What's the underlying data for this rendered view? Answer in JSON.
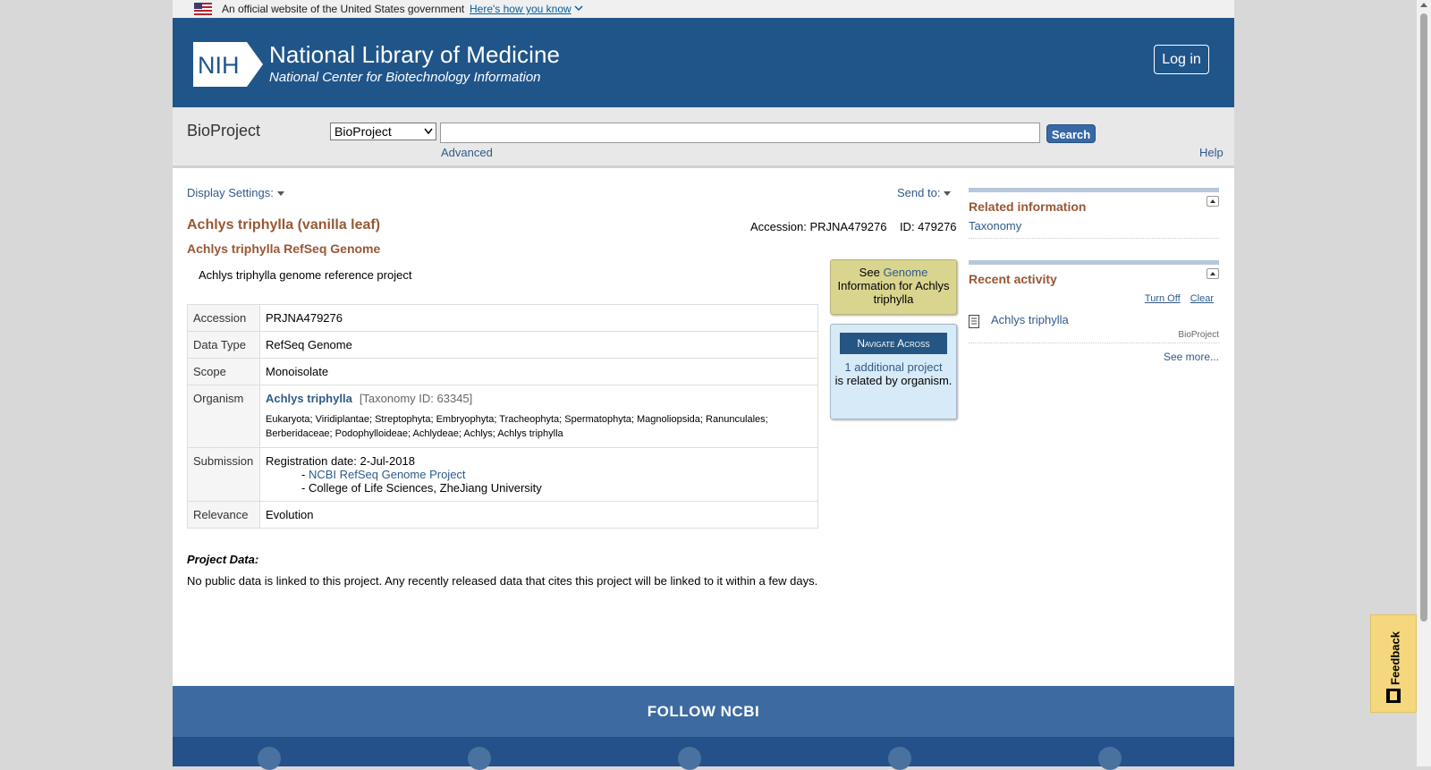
{
  "gov_banner": {
    "text": "An official website of the United States government",
    "link": "Here's how you know"
  },
  "header": {
    "logo_text": "NIH",
    "title": "National Library of Medicine",
    "subtitle": "National Center for Biotechnology Information",
    "login": "Log in"
  },
  "search": {
    "db_name": "BioProject",
    "db_selected": "BioProject",
    "query": "",
    "button": "Search",
    "advanced": "Advanced",
    "help": "Help"
  },
  "toolbar": {
    "display_settings": "Display Settings:",
    "send_to": "Send to:"
  },
  "record": {
    "title": "Achlys triphylla (vanilla leaf)",
    "accession_line": "Accession: PRJNA479276",
    "id_line": "ID: 479276",
    "subtitle": "Achlys triphylla RefSeq Genome",
    "description": "Achlys triphylla genome reference project",
    "rows": {
      "accession": {
        "label": "Accession",
        "value": "PRJNA479276"
      },
      "data_type": {
        "label": "Data Type",
        "value": "RefSeq Genome"
      },
      "scope": {
        "label": "Scope",
        "value": "Monoisolate"
      },
      "organism": {
        "label": "Organism",
        "name": "Achlys triphylla",
        "taxonomy_id": "[Taxonomy ID: 63345]",
        "lineage": "Eukaryota; Viridiplantae; Streptophyta; Embryophyta; Tracheophyta; Spermatophyta; Magnoliopsida; Ranunculales; Berberidaceae; Podophylloideae; Achlydeae; Achlys; Achlys triphylla"
      },
      "submission": {
        "label": "Submission",
        "registration": "Registration date: 2-Jul-2018",
        "org_link_prefix": "- ",
        "org_link": "NCBI RefSeq Genome Project",
        "org2": "- College of Life Sciences, ZheJiang University"
      },
      "relevance": {
        "label": "Relevance",
        "value": "Evolution"
      }
    },
    "project_data_heading": "Project Data:",
    "project_data_text": "No public data is linked to this project. Any recently released data that cites this project will be linked to it within a few days."
  },
  "genome_box": {
    "see": "See",
    "link": "Genome",
    "rest": "Information for Achlys triphylla"
  },
  "navigate_box": {
    "button": "Navigate Across",
    "link": "1 additional project",
    "rest": "is related by organism."
  },
  "sidebar": {
    "related": {
      "heading": "Related information",
      "items": [
        "Taxonomy"
      ]
    },
    "recent": {
      "heading": "Recent activity",
      "turn_off": "Turn Off",
      "clear": "Clear",
      "item_name": "Achlys triphylla",
      "item_source": "BioProject",
      "see_more": "See more..."
    }
  },
  "footer": {
    "follow": "FOLLOW NCBI"
  },
  "feedback": {
    "label": "Feedback"
  },
  "colors": {
    "header_bg": "#20558a",
    "title_brown": "#985735",
    "link_blue": "#2f5a8b",
    "footer_bg": "#3d6ba1",
    "genome_box": "#d9d58f",
    "navigate_box": "#d7eaf7"
  }
}
